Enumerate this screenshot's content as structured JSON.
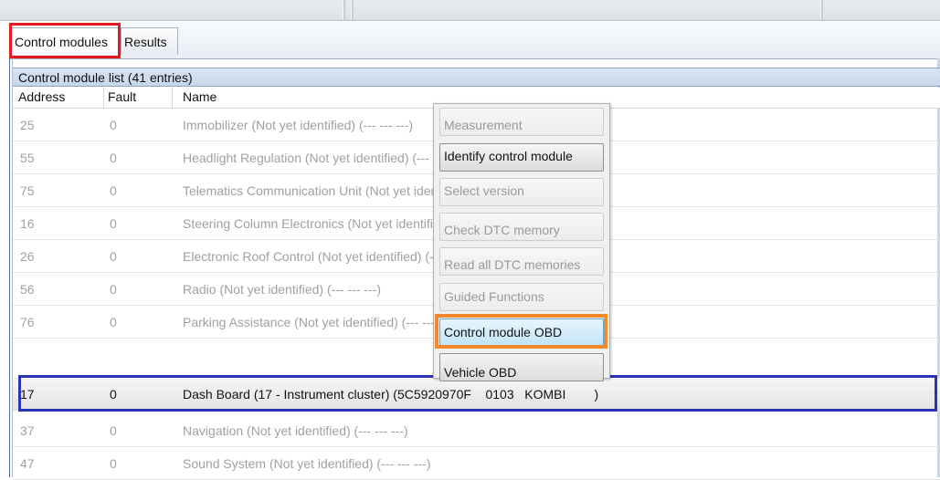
{
  "window": {
    "title_fragment": ""
  },
  "tabs": [
    {
      "label": "Control modules",
      "active": true
    },
    {
      "label": "Results",
      "active": false
    }
  ],
  "list": {
    "header": "Control module list (41 entries)",
    "columns": [
      "Address",
      "Fault",
      "Name"
    ],
    "rows": [
      {
        "address": "25",
        "fault": "0",
        "name": "Immobilizer (Not yet identified) (---   ---   ---)",
        "selected": false
      },
      {
        "address": "55",
        "fault": "0",
        "name": "Headlight Regulation (Not yet identified) (---   ---   ---)",
        "selected": false
      },
      {
        "address": "75",
        "fault": "0",
        "name": "Telematics Communication Unit (Not yet identified) (---   ---   ---)",
        "selected": false
      },
      {
        "address": "16",
        "fault": "0",
        "name": "Steering Column Electronics (Not yet identified) (---   ---   ---)",
        "selected": false
      },
      {
        "address": "26",
        "fault": "0",
        "name": "Electronic Roof Control (Not yet identified) (---   ---   ---)",
        "selected": false
      },
      {
        "address": "56",
        "fault": "0",
        "name": "Radio (Not yet identified) (---   ---   ---)",
        "selected": false
      },
      {
        "address": "76",
        "fault": "0",
        "name": "Parking Assistance (Not yet identified) (---   ---   ---)",
        "selected": false
      },
      {
        "address": "17",
        "fault": "0",
        "name": "Dash Board (17 - Instrument cluster) (5C5920970F    0103   KOMBI        )",
        "selected": true
      },
      {
        "address": "37",
        "fault": "0",
        "name": "Navigation (Not yet identified) (---   ---   ---)",
        "selected": false
      },
      {
        "address": "47",
        "fault": "0",
        "name": "Sound System (Not yet identified) (---   ---   ---)",
        "selected": false
      }
    ]
  },
  "context_menu": {
    "items": [
      {
        "label": "Measurement",
        "enabled": false
      },
      {
        "label": "Identify control module",
        "enabled": true
      },
      {
        "label": "Select version",
        "enabled": false
      },
      {
        "label": "Check DTC memory",
        "enabled": false
      },
      {
        "label": "Read all DTC memories",
        "enabled": false
      },
      {
        "label": "Guided Functions",
        "enabled": false
      },
      {
        "label": "Control module OBD",
        "enabled": true,
        "highlighted": true
      },
      {
        "label": "Vehicle OBD",
        "enabled": true
      }
    ]
  },
  "annotation_colors": {
    "tab_box": "#e41b23",
    "row_box": "#2b34b8",
    "menu_box": "#f08a2c"
  }
}
